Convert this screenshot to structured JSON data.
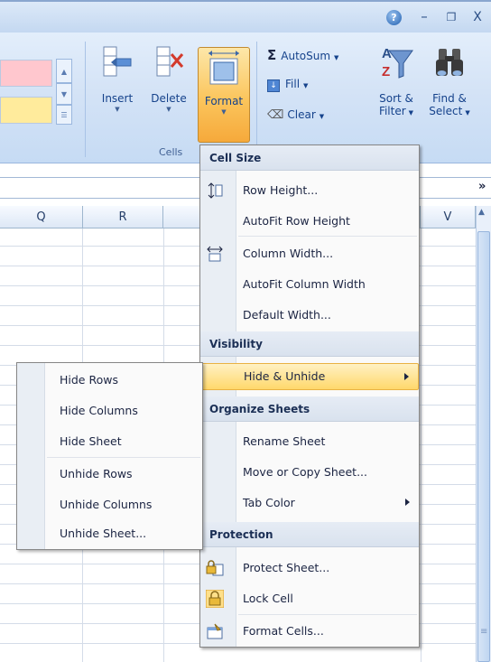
{
  "window": {
    "help_glyph": "?",
    "minimize_glyph": "–",
    "restore_glyph": "❐",
    "close_glyph": "X"
  },
  "ribbon": {
    "cells_group_label": "Cells",
    "insert_label": "Insert",
    "delete_label": "Delete",
    "format_label": "Format",
    "autosum_label": "AutoSum",
    "fill_label": "Fill",
    "clear_label": "Clear",
    "sort_filter_line1": "Sort &",
    "sort_filter_line2": "Filter",
    "find_select_line1": "Find &",
    "find_select_line2": "Select",
    "sigma_glyph": "Σ"
  },
  "grid": {
    "columns": [
      "Q",
      "R",
      "V"
    ],
    "expand_glyph": "»"
  },
  "format_menu": {
    "sections": {
      "cell_size": "Cell Size",
      "visibility": "Visibility",
      "organize": "Organize Sheets",
      "protection": "Protection"
    },
    "items": {
      "row_height": "Row Height...",
      "autofit_row": "AutoFit Row Height",
      "column_width": "Column Width...",
      "autofit_column": "AutoFit Column Width",
      "default_width": "Default Width...",
      "hide_unhide": "Hide & Unhide",
      "rename_sheet": "Rename Sheet",
      "move_copy": "Move or Copy Sheet...",
      "tab_color": "Tab Color",
      "protect_sheet": "Protect Sheet...",
      "lock_cell": "Lock Cell",
      "format_cells": "Format Cells..."
    }
  },
  "hide_submenu": {
    "items": [
      "Hide Rows",
      "Hide Columns",
      "Hide Sheet",
      "Unhide Rows",
      "Unhide Columns",
      "Unhide Sheet..."
    ]
  },
  "colors": {
    "ribbon_bg": "#d4e3f6",
    "highlight": "#ffd86b",
    "section_bg": "#dde5f0"
  }
}
